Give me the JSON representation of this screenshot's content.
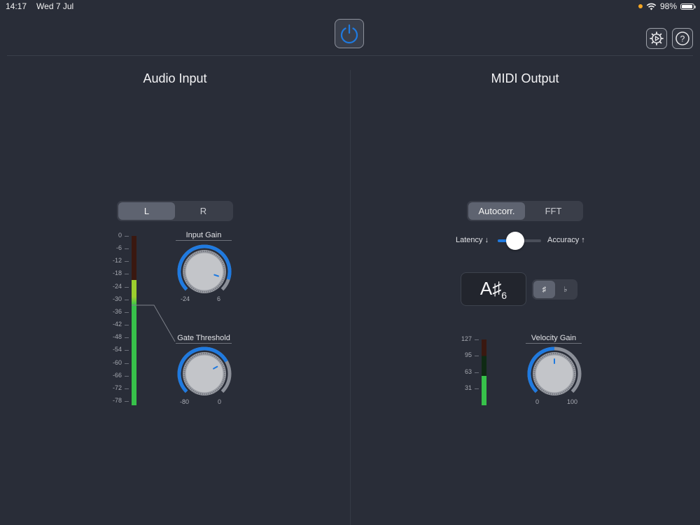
{
  "status": {
    "time": "14:17",
    "date": "Wed 7 Jul",
    "battery": "98%"
  },
  "audio_input": {
    "title": "Audio Input",
    "channel_tabs": [
      "L",
      "R"
    ],
    "channel_selected": "L",
    "meter_ticks": [
      "0",
      "-6",
      "-12",
      "-18",
      "-24",
      "-30",
      "-36",
      "-42",
      "-48",
      "-54",
      "-60",
      "-66",
      "-72",
      "-78"
    ],
    "meter_level_db": -21,
    "gate_marker_db": -33,
    "input_gain": {
      "label": "Input Gain",
      "min": "-24",
      "max": "6",
      "value": 3
    },
    "gate_threshold": {
      "label": "Gate Threshold",
      "min": "-80",
      "max": "0",
      "value": -22
    }
  },
  "midi_output": {
    "title": "MIDI Output",
    "algorithm_tabs": [
      "Autocorr.",
      "FFT"
    ],
    "algorithm_selected": "Autocorr.",
    "slider": {
      "left_label": "Latency ↓",
      "right_label": "Accuracy ↑",
      "value": 0.4
    },
    "note": {
      "name": "A♯",
      "octave": "6"
    },
    "accidental_tabs": [
      "♯",
      "♭"
    ],
    "accidental_selected": "♯",
    "velocity_ticks": [
      "127",
      "95",
      "63",
      "31"
    ],
    "velocity_level": 45,
    "velocity_gain": {
      "label": "Velocity Gain",
      "min": "0",
      "max": "100",
      "value": 50
    }
  },
  "colors": {
    "accent": "#1f7ae0",
    "meter_green": "#37c24a",
    "meter_yellow": "#9ccf2e",
    "background": "#292d38"
  },
  "icons": [
    "power-icon",
    "settings-icon",
    "help-icon",
    "wifi-icon",
    "battery-icon"
  ]
}
